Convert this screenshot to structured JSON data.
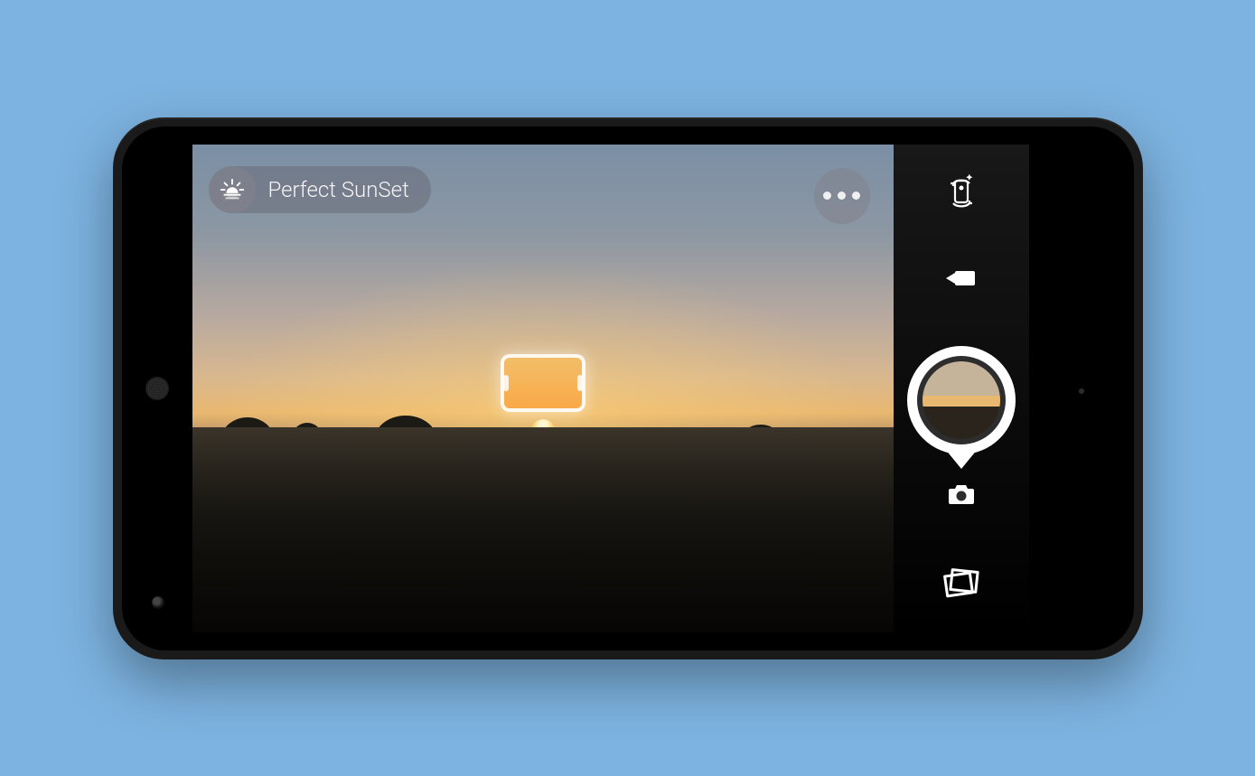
{
  "mode": {
    "label": "Perfect SunSet",
    "icon": "sunset-icon"
  },
  "controls": {
    "more": "more-icon",
    "switch_camera": "switch-camera-icon",
    "video": "video-icon",
    "shutter": "shutter-button",
    "camera_mode": "camera-icon",
    "gallery": "gallery-icon"
  },
  "colors": {
    "page_bg": "#7db3e0",
    "pill_bg": "rgba(100,100,110,0.45)",
    "control_fg": "#ffffff"
  }
}
